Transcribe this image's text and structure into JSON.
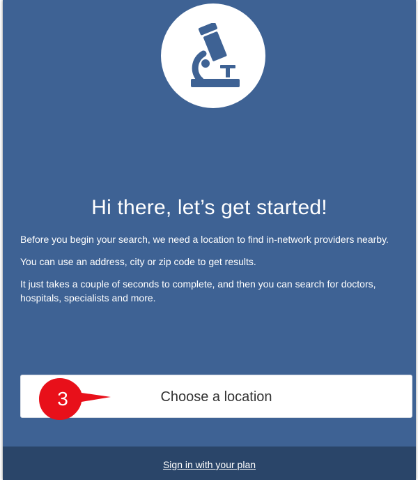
{
  "hero": {
    "icon": "microscope-icon"
  },
  "headline": "Hi there, let’s get started!",
  "paragraphs": [
    "Before you begin your search, we need a location to find in-network providers nearby.",
    "You can use an address, city or zip code to get results.",
    "It just takes a couple of seconds to complete, and then you can search for doctors, hospitals, specialists and more."
  ],
  "cta": {
    "label": "Choose a location"
  },
  "step_marker": {
    "number": "3",
    "color": "#e8101a"
  },
  "footer": {
    "signin_label": "Sign in with your plan"
  },
  "colors": {
    "panel": "#3e6294",
    "footer": "#2a4569",
    "icon": "#3e6294"
  }
}
